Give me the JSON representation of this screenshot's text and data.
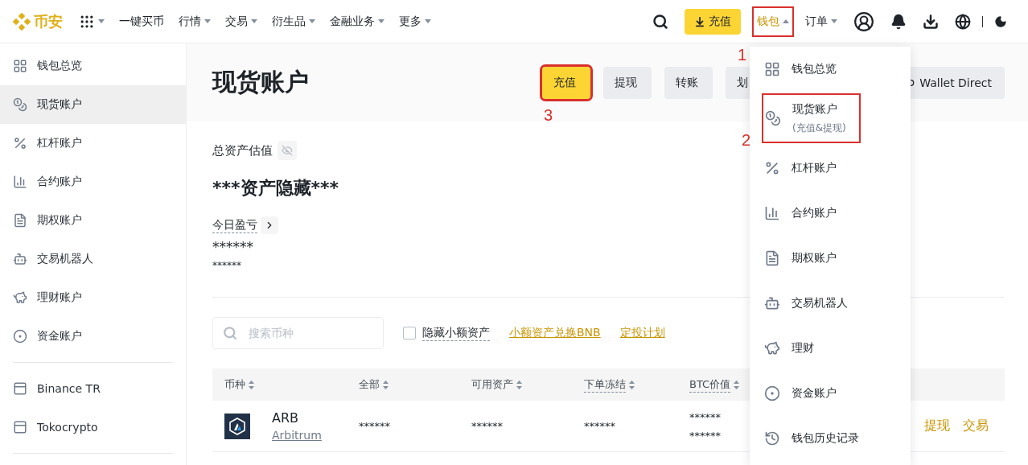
{
  "header": {
    "logo": "币安",
    "nav": [
      {
        "label": "一键买币",
        "dropdown": false
      },
      {
        "label": "行情",
        "dropdown": true
      },
      {
        "label": "交易",
        "dropdown": true
      },
      {
        "label": "衍生品",
        "dropdown": true
      },
      {
        "label": "金融业务",
        "dropdown": true
      },
      {
        "label": "更多",
        "dropdown": true
      }
    ],
    "deposit_button": "充值",
    "menus": [
      {
        "label": "钱包",
        "open": true,
        "annotation": "1"
      },
      {
        "label": "订单",
        "open": false
      }
    ]
  },
  "sidebar": {
    "items": [
      {
        "label": "钱包总览",
        "selected": false
      },
      {
        "label": "现货账户",
        "selected": true
      },
      {
        "label": "杠杆账户",
        "selected": false
      },
      {
        "label": "合约账户",
        "selected": false
      },
      {
        "label": "期权账户",
        "selected": false
      },
      {
        "label": "交易机器人",
        "selected": false
      },
      {
        "label": "理财账户",
        "selected": false
      },
      {
        "label": "资金账户",
        "selected": false
      }
    ],
    "external": [
      {
        "label": "Binance TR"
      },
      {
        "label": "Tokocrypto"
      }
    ]
  },
  "page": {
    "title": "现货账户",
    "actions": [
      {
        "label": "充值",
        "primary": true,
        "annotation": "3"
      },
      {
        "label": "提现",
        "primary": false
      },
      {
        "label": "转账",
        "primary": false
      },
      {
        "label": "划",
        "primary": false
      }
    ],
    "wallet_direct": "Wallet Direct",
    "balance": {
      "label": "总资产估值",
      "value": "***资产隐藏***",
      "pnl_label": "今日盈亏",
      "pnl_value": "******",
      "pnl_sub": "******"
    },
    "toolbar": {
      "search_placeholder": "搜索币种",
      "hide_small": {
        "label": "隐藏小额资产",
        "checked": false
      },
      "links": [
        "小额资产兑换BNB",
        "定投计划"
      ]
    },
    "table": {
      "columns": [
        {
          "label": "币种",
          "dotted": false
        },
        {
          "label": "全部",
          "dotted": false
        },
        {
          "label": "可用资产",
          "dotted": false
        },
        {
          "label": "下单冻结",
          "dotted": true
        },
        {
          "label": "BTC价值",
          "dotted": true
        }
      ],
      "rows": [
        {
          "symbol": "ARB",
          "name": "Arbitrum",
          "total": "******",
          "available": "******",
          "frozen": "******",
          "btc_value": [
            "******",
            "******"
          ],
          "actions": [
            "提现",
            "交易"
          ]
        }
      ]
    }
  },
  "wallet_menu": {
    "items": [
      {
        "label": "钱包总览"
      },
      {
        "label": "现货账户",
        "note": "(充值&提现)",
        "annotation": "2"
      },
      {
        "label": "杠杆账户"
      },
      {
        "label": "合约账户"
      },
      {
        "label": "期权账户"
      },
      {
        "label": "交易机器人"
      },
      {
        "label": "理财"
      },
      {
        "label": "资金账户"
      },
      {
        "label": "钱包历史记录"
      }
    ]
  }
}
